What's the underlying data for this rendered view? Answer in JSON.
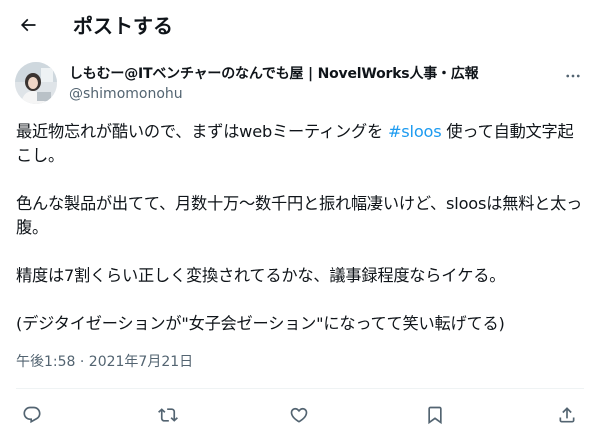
{
  "header": {
    "title": "ポストする",
    "back_icon": "arrow-left-icon"
  },
  "post": {
    "author_name": "しもむー@ITベンチャーのなんでも屋 | NovelWorks人事・広報",
    "author_handle": "@shimomonohu",
    "text": {
      "p1_before": "最近物忘れが酷いので、まずはwebミーティングを ",
      "p1_hashtag": "#sloos",
      "p1_after": " 使って自動文字起こし。",
      "p2": "色んな製品が出てて、月数十万〜数千円と振れ幅凄いけど、sloosは無料と太っ腹。",
      "p3": "精度は7割くらい正しく変換されてるかな、議事録程度ならイケる。",
      "p4": "(デジタイゼーションが\"女子会ゼーション\"になってて笑い転げてる)"
    },
    "timestamp": "午後1:58 · 2021年7月21日",
    "actions": [
      "reply-icon",
      "repost-icon",
      "like-icon",
      "bookmark-icon",
      "share-icon"
    ]
  },
  "colors": {
    "text": "#0f1419",
    "secondary": "#536471",
    "accent": "#1d9bf0",
    "divider": "#eff3f4"
  }
}
